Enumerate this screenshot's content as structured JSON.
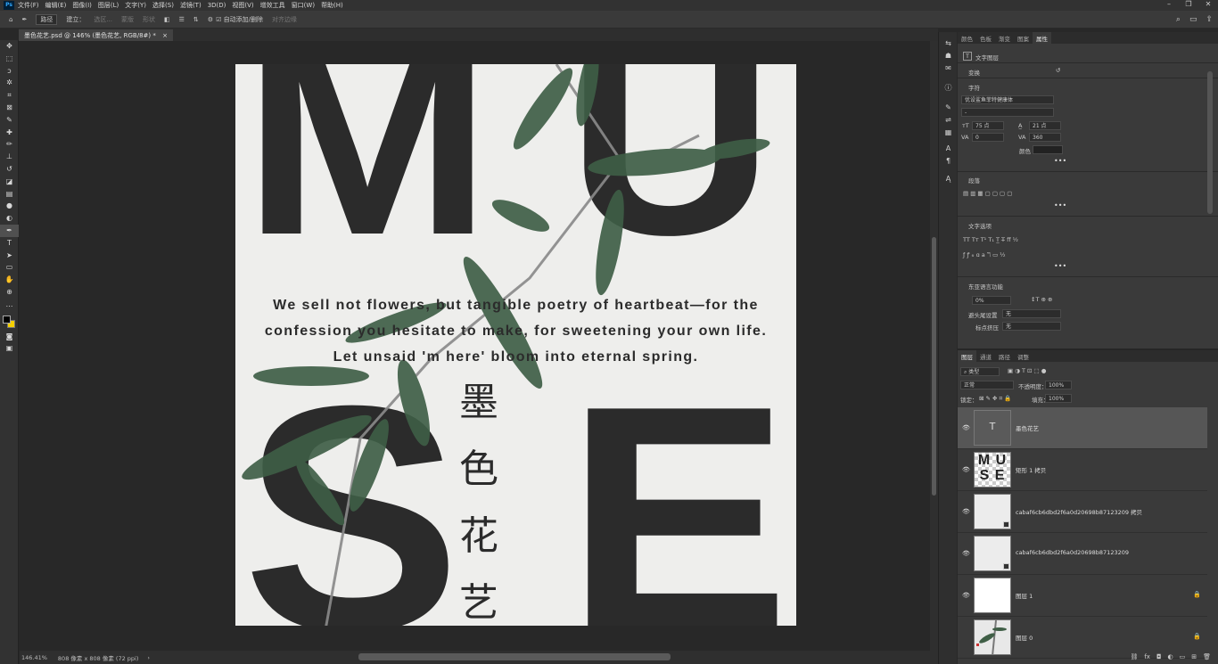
{
  "app": {
    "logo": "Ps"
  },
  "menu": [
    "文件(F)",
    "编辑(E)",
    "图像(I)",
    "图层(L)",
    "文字(Y)",
    "选择(S)",
    "滤镜(T)",
    "3D(D)",
    "视图(V)",
    "增效工具",
    "窗口(W)",
    "帮助(H)"
  ],
  "window_controls": [
    "–",
    "❐",
    "✕"
  ],
  "options_bar": {
    "home_icon": "home-icon",
    "tool_icon": "pen-icon",
    "mode": "路径",
    "make_label": "建立：",
    "selection_btn": "选区...",
    "mask_btn": "蒙版",
    "shape_btn": "形状",
    "auto_add_label": "自动添加/删除",
    "auto_add_checked": true,
    "align_edges": "对齐边缘"
  },
  "document_tab": {
    "title": "墨色花艺.psd @ 146% (墨色花艺, RGB/8#) *",
    "close": "×"
  },
  "status": {
    "zoom": "146.41%",
    "doc_size": "808 像素 x 808 像素 (72 ppi)",
    "arrow": "›"
  },
  "artwork": {
    "letters": [
      "M",
      "U",
      "S",
      "E"
    ],
    "body_text": "We sell not flowers, but tangible poetry of heartbeat—for the confession you hesitate to make, for sweetening your own life. Let unsaid 'm here' bloom into eternal spring.",
    "vertical_chars": [
      "墨",
      "色",
      "花",
      "艺"
    ],
    "colors": {
      "ink": "#2b2b2b",
      "paper": "#eeeeec",
      "leaf": "#3f5e46"
    }
  },
  "tools": [
    "move-icon",
    "marquee-icon",
    "lasso-icon",
    "magic-wand-icon",
    "crop-icon",
    "frame-icon",
    "eyedropper-icon",
    "healing-icon",
    "brush-icon",
    "stamp-icon",
    "history-brush-icon",
    "eraser-icon",
    "gradient-icon",
    "blur-icon",
    "dodge-icon",
    "pen-icon",
    "type-icon",
    "path-select-icon",
    "shape-icon",
    "hand-icon",
    "zoom-icon",
    "more-icon"
  ],
  "properties": {
    "tabs": [
      "颜色",
      "色板",
      "渐变",
      "图案",
      "属性"
    ],
    "active_tab": "属性",
    "layer_type": "文字图层",
    "transform": "变换",
    "character": "字符",
    "font_family": "优设鲨鱼菲特健康体",
    "font_style": "-",
    "font_size": "75 点",
    "leading": "21 点",
    "kerning": "0",
    "tracking": "360",
    "color_label": "颜色",
    "paragraph": "段落",
    "text_options": "文字选项",
    "east_asian": "东亚语言功能",
    "tsume": "0%",
    "mojikumi_label": "避头尾设置",
    "mojikumi_value": "无",
    "kumi_label": "标点挤压",
    "kumi_value": "无",
    "more": "•••"
  },
  "layers_panel": {
    "tabs": [
      "图层",
      "通道",
      "路径",
      "调整"
    ],
    "active_tab": "图层",
    "filter": "类型",
    "blend_mode": "正常",
    "opacity_label": "不透明度：",
    "opacity": "100%",
    "lock_label": "锁定：",
    "fill_label": "填充：",
    "fill": "100%",
    "layers": [
      {
        "name": "墨色花艺",
        "kind": "text",
        "visible": true,
        "selected": true,
        "locked": false
      },
      {
        "name": "矩形 1 拷贝",
        "kind": "muse",
        "visible": true,
        "selected": false,
        "locked": false
      },
      {
        "name": "cabaf6cb6dbd2f6a0d20698b87123209 拷贝",
        "kind": "smart",
        "visible": true,
        "selected": false,
        "locked": false
      },
      {
        "name": "cabaf6cb6dbd2f6a0d20698b87123209",
        "kind": "smart",
        "visible": true,
        "selected": false,
        "locked": false
      },
      {
        "name": "图层 1",
        "kind": "white",
        "visible": true,
        "selected": false,
        "locked": true
      },
      {
        "name": "图层 0",
        "kind": "photo",
        "visible": false,
        "selected": false,
        "locked": true
      }
    ],
    "footer": [
      "link-icon",
      "fx-icon",
      "mask-icon",
      "adjust-icon",
      "folder-icon",
      "new-layer-icon",
      "trash-icon"
    ]
  }
}
